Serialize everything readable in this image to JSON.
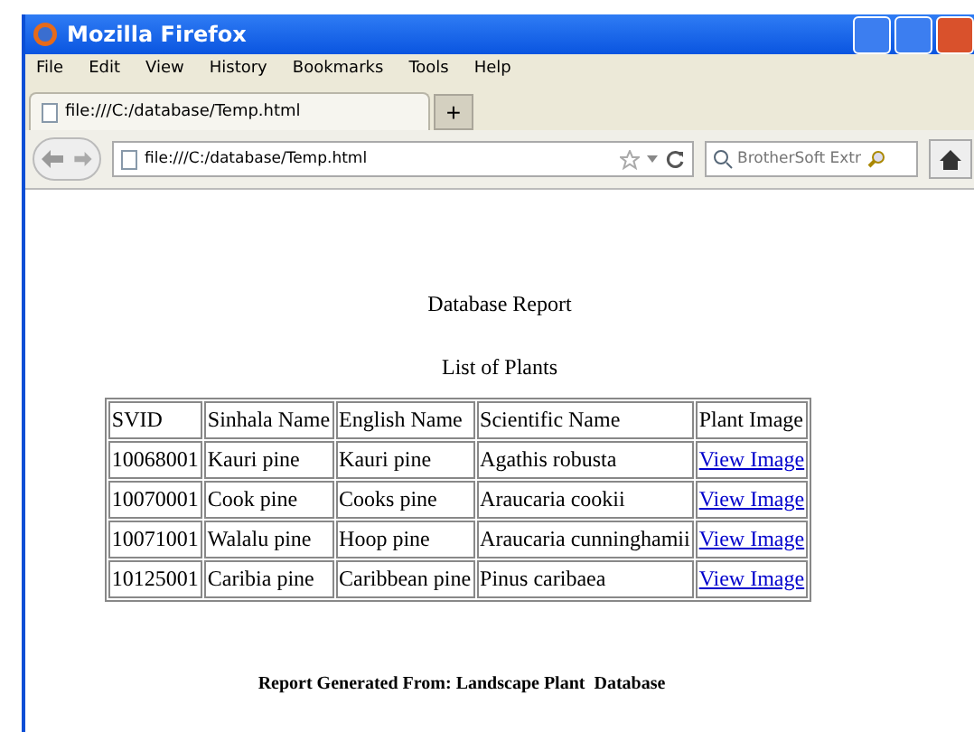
{
  "window": {
    "title": "Mozilla Firefox"
  },
  "menu": [
    "File",
    "Edit",
    "View",
    "History",
    "Bookmarks",
    "Tools",
    "Help"
  ],
  "tabs": [
    {
      "label": "file:///C:/database/Temp.html",
      "selected": true
    }
  ],
  "new_tab_button": "+",
  "address_bar": {
    "value": "file:///C:/database/Temp.html"
  },
  "search_field": {
    "placeholder": "BrotherSoft Extr"
  },
  "page": {
    "heading": "Database Report",
    "subheading": "List of Plants",
    "table": {
      "columns": [
        "SVID",
        "Sinhala Name",
        "English Name",
        "Scientific Name",
        "Plant Image"
      ],
      "rows": [
        [
          "10068001",
          "Kauri pine",
          "Kauri pine",
          "Agathis robusta",
          "View Image"
        ],
        [
          "10070001",
          "Cook pine",
          "Cooks pine",
          "Araucaria cookii",
          "View Image"
        ],
        [
          "10071001",
          "Walalu pine",
          "Hoop pine",
          "Araucaria cunninghamii",
          "View Image"
        ],
        [
          "10125001",
          "Caribia pine",
          "Caribbean pine",
          "Pinus caribaea",
          "View Image"
        ]
      ]
    },
    "footer": "Report Generated From: Landscape Plant  Database"
  }
}
